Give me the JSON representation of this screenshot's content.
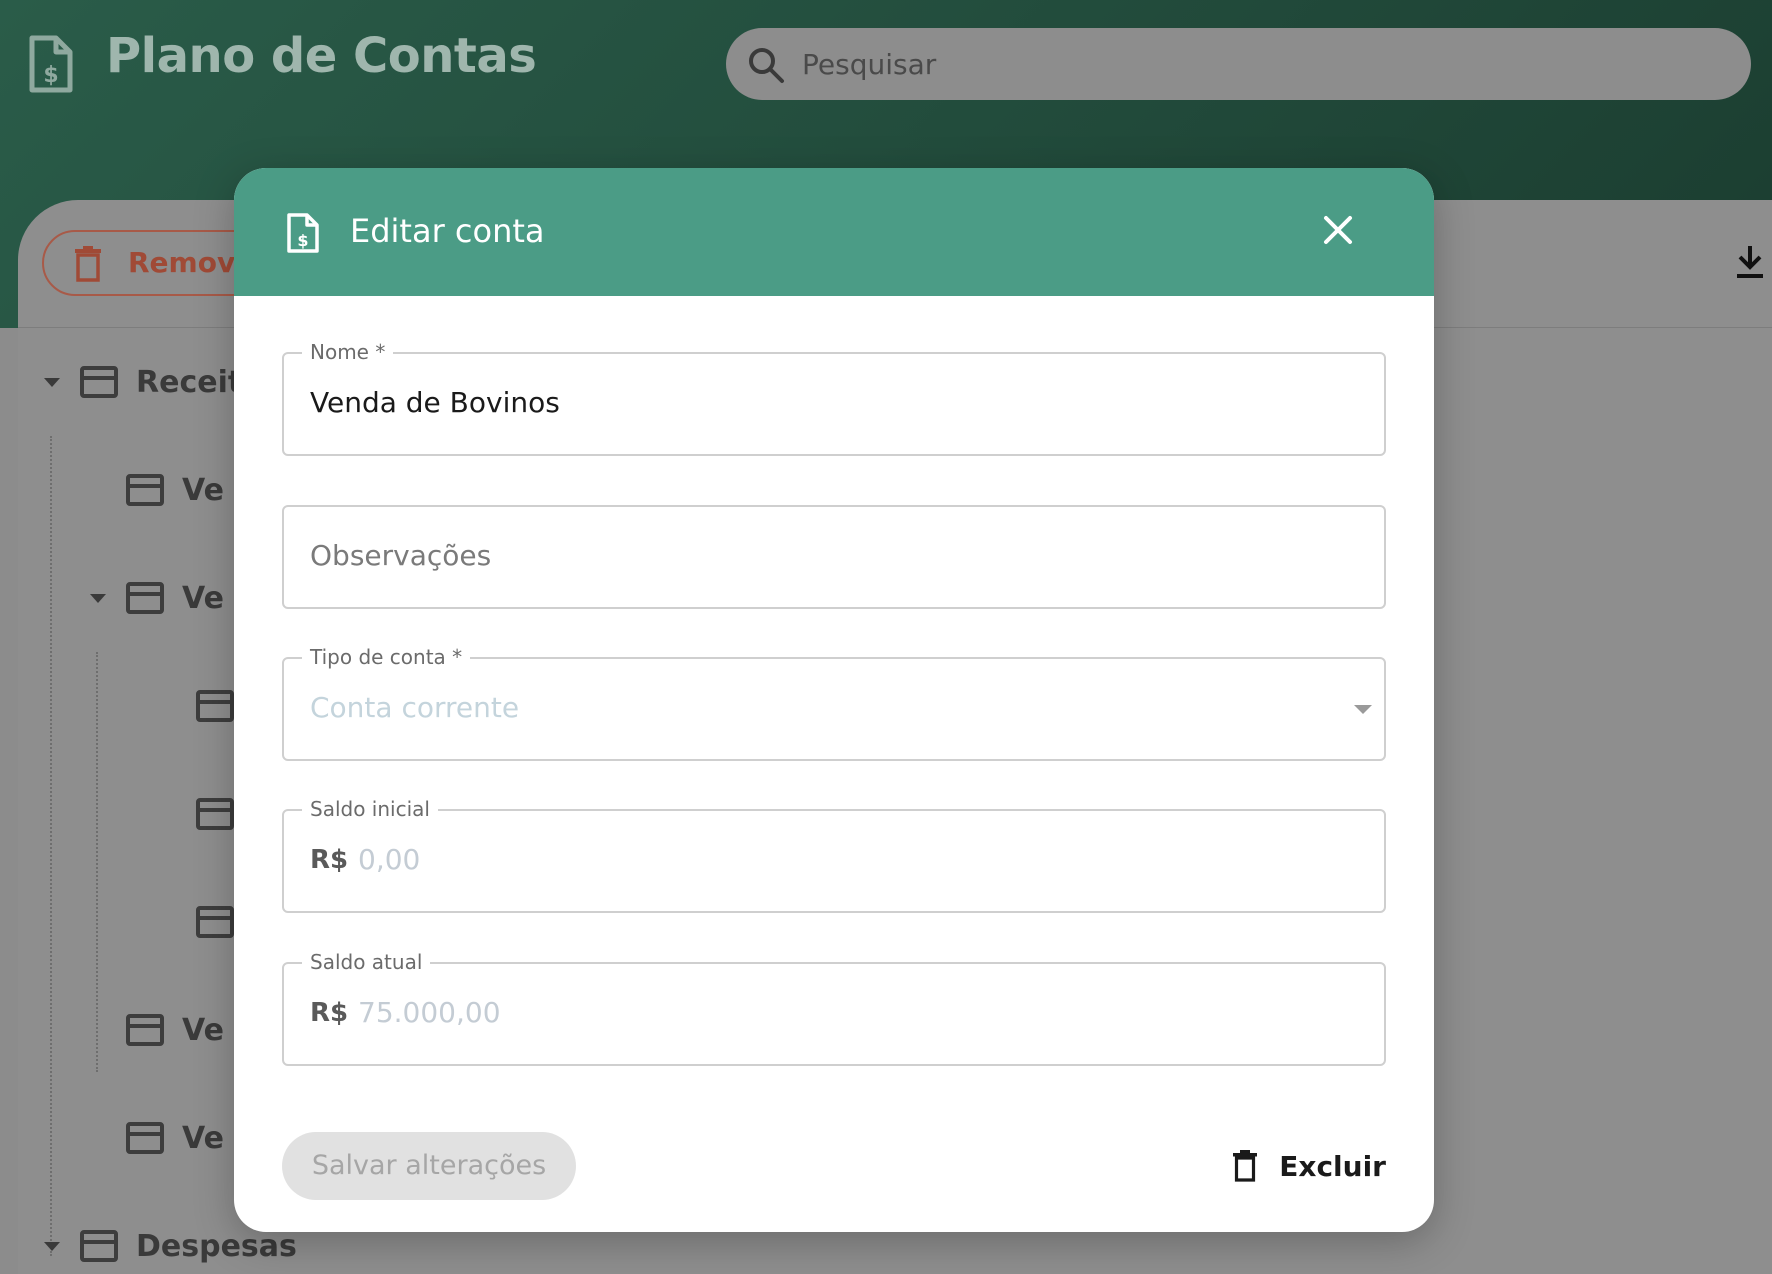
{
  "app": {
    "title": "Plano de Contas",
    "search_placeholder": "Pesquisar"
  },
  "toolbar": {
    "remove_label": "Remover",
    "export_label": "E"
  },
  "tree": {
    "items": [
      {
        "label": "Receit"
      },
      {
        "label": "Ve"
      },
      {
        "label": "Ve"
      },
      {
        "label": ""
      },
      {
        "label": ""
      },
      {
        "label": ""
      },
      {
        "label": "Ve"
      },
      {
        "label": "Ve"
      },
      {
        "label": "Despesas"
      }
    ]
  },
  "modal": {
    "title": "Editar conta",
    "fields": {
      "nome": {
        "label": "Nome *",
        "value": "Venda de Bovinos"
      },
      "observacoes": {
        "placeholder": "Observações"
      },
      "tipo": {
        "label": "Tipo de conta *",
        "value": "Conta corrente"
      },
      "saldo_inicial": {
        "label": "Saldo inicial",
        "prefix": "R$",
        "value": "0,00"
      },
      "saldo_atual": {
        "label": "Saldo atual",
        "prefix": "R$",
        "value": "75.000,00"
      }
    },
    "save_label": "Salvar alterações",
    "delete_label": "Excluir"
  },
  "colors": {
    "header_bg": "#1b3d30",
    "modal_header": "#4b9c86",
    "remove_accent": "#a04a36"
  }
}
